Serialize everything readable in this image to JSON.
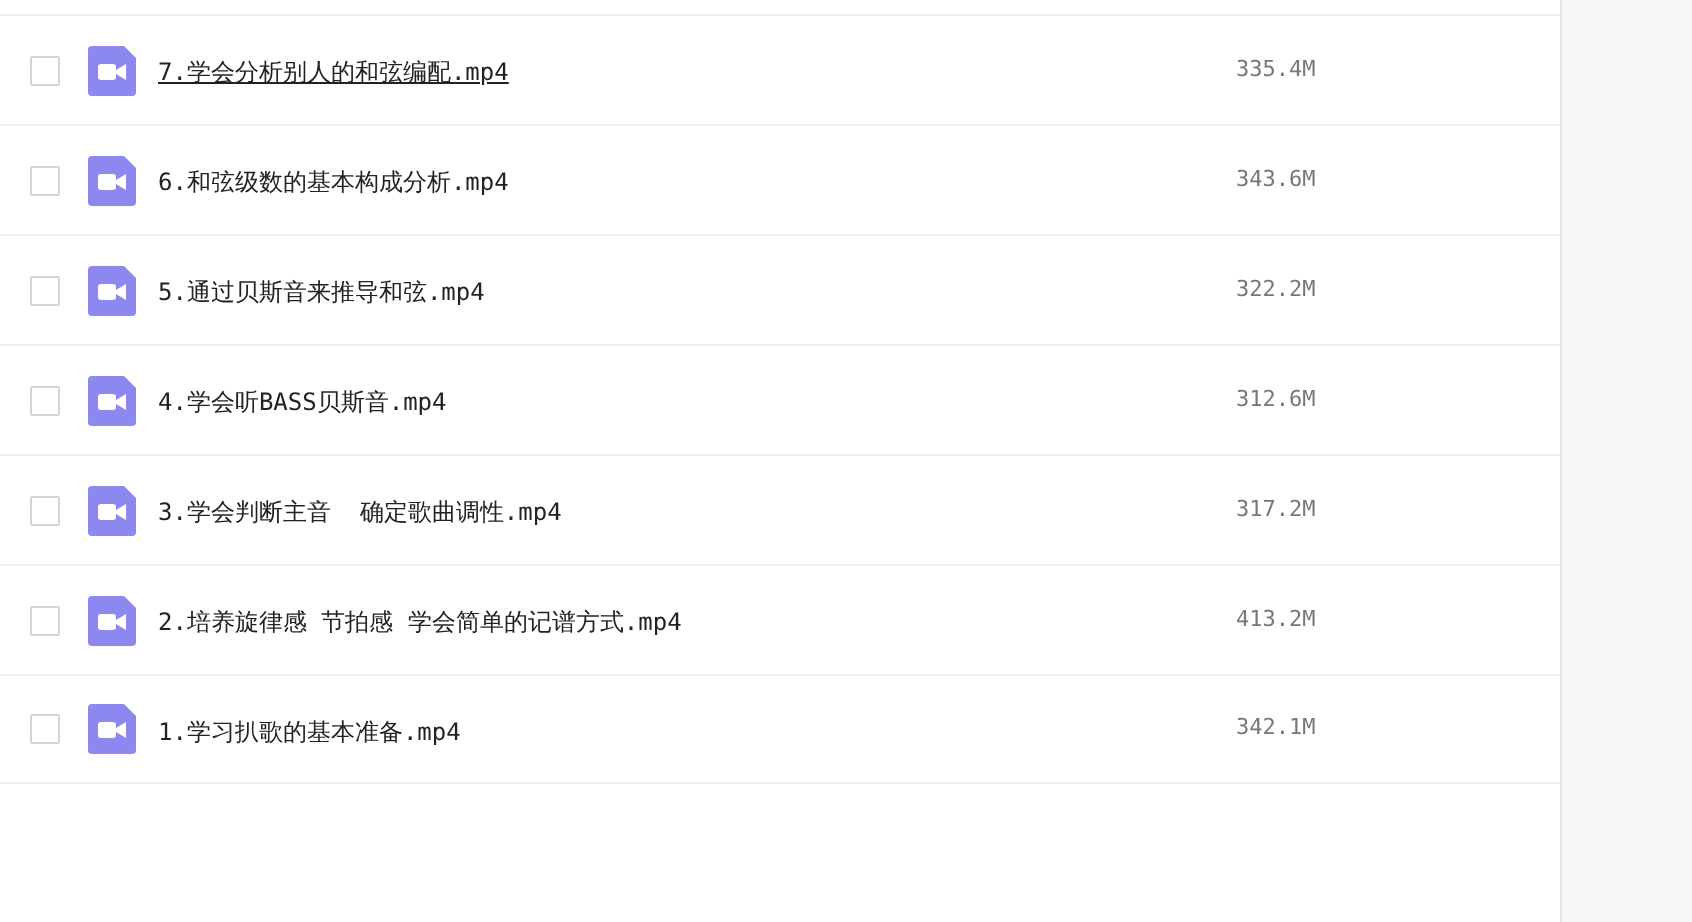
{
  "files": [
    {
      "name": "7.学会分析别人的和弦编配.mp4",
      "size": "335.4M",
      "checked": false,
      "hovered": true
    },
    {
      "name": "6.和弦级数的基本构成分析.mp4",
      "size": "343.6M",
      "checked": false,
      "hovered": false
    },
    {
      "name": "5.通过贝斯音来推导和弦.mp4",
      "size": "322.2M",
      "checked": false,
      "hovered": false
    },
    {
      "name": "4.学会听BASS贝斯音.mp4",
      "size": "312.6M",
      "checked": false,
      "hovered": false
    },
    {
      "name": "3.学会判断主音  确定歌曲调性.mp4",
      "size": "317.2M",
      "checked": false,
      "hovered": false
    },
    {
      "name": "2.培养旋律感 节拍感 学会简单的记谱方式.mp4",
      "size": "413.2M",
      "checked": false,
      "hovered": false
    },
    {
      "name": "1.学习扒歌的基本准备.mp4",
      "size": "342.1M",
      "checked": false,
      "hovered": false
    }
  ]
}
